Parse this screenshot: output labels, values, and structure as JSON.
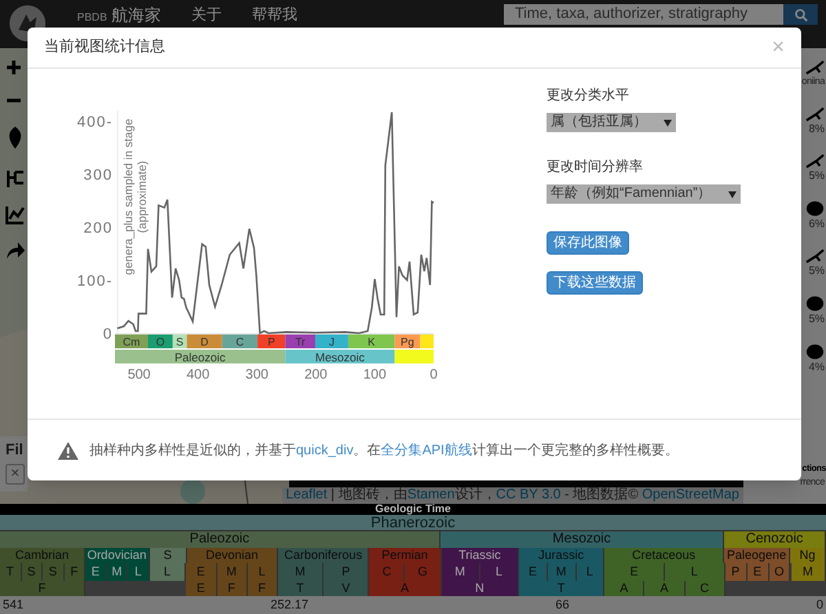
{
  "navbar": {
    "logo_small": "PBDB",
    "brand": "航海家",
    "links": [
      "关于",
      "帮帮我"
    ],
    "search": {
      "placeholder": "Time, taxa, authorizer, stratigraphy"
    }
  },
  "sidebar": {
    "filter_label": "Fil",
    "filter_clear": "×"
  },
  "taxa_panel": {
    "items": [
      {
        "kind": "bird",
        "text": "oniina"
      },
      {
        "kind": "bird",
        "text": "8%"
      },
      {
        "kind": "bird",
        "text": "5%"
      },
      {
        "kind": "blob",
        "text": "6%"
      },
      {
        "kind": "bird",
        "text": "5%"
      },
      {
        "kind": "blob",
        "text": "5%"
      },
      {
        "kind": "blob",
        "text": "4%"
      }
    ],
    "footer": [
      "ctions",
      "rrence"
    ]
  },
  "map": {
    "kind": "picture",
    "attribution": [
      {
        "kind": "link",
        "text": "Leaflet"
      },
      {
        "kind": "text",
        "text": " | 地图砖，由"
      },
      {
        "kind": "link",
        "text": "Stamen"
      },
      {
        "kind": "text",
        "text": "设计，"
      },
      {
        "kind": "link",
        "text": "CC BY 3.0"
      },
      {
        "kind": "text",
        "text": " - 地图数据© "
      },
      {
        "kind": "link",
        "text": "OpenStreetMap"
      }
    ]
  },
  "modal": {
    "title": "当前视图统计信息",
    "close": "×",
    "chart_data": {
      "type": "line",
      "xlim": [
        541,
        0
      ],
      "ylim": [
        0,
        420
      ],
      "ylabel": "genera_plus sampled in stage (approximate)",
      "xticks": [
        500,
        400,
        300,
        200,
        100,
        0
      ],
      "yticks": [
        {
          "value": 0,
          "label": "0"
        },
        {
          "value": 100,
          "label": "100-"
        },
        {
          "value": 200,
          "label": "200"
        },
        {
          "value": 300,
          "label": "300"
        },
        {
          "value": 400,
          "label": "400-"
        }
      ],
      "x": [
        537,
        526,
        518,
        510,
        506,
        502,
        501,
        488,
        485,
        479,
        471,
        467,
        457,
        452,
        444,
        438,
        432,
        428,
        424,
        420,
        416,
        409,
        393,
        387,
        381,
        371,
        360,
        346,
        330,
        323,
        313,
        305,
        301,
        295,
        288,
        280,
        250,
        200,
        150,
        127,
        112,
        105,
        100,
        95,
        90,
        84,
        82,
        71,
        63,
        59,
        53,
        45,
        41,
        34,
        27,
        21,
        16,
        12,
        6,
        3,
        0
      ],
      "series": [
        {
          "color": "#666666",
          "values": [
            9,
            13,
            23,
            17,
            4,
            4,
            37,
            37,
            159,
            116,
            126,
            241,
            237,
            252,
            67,
            122,
            100,
            67,
            65,
            48,
            39,
            22,
            168,
            163,
            91,
            50,
            91,
            148,
            170,
            122,
            197,
            161,
            109,
            0,
            4,
            0,
            2,
            1,
            2,
            0,
            4,
            48,
            102,
            65,
            35,
            35,
            317,
            417,
            30,
            126,
            109,
            100,
            135,
            35,
            39,
            148,
            117,
            142,
            91,
            248,
            246
          ]
        }
      ]
    },
    "periods": [
      {
        "label": "Cm",
        "color": "#7fa056"
      },
      {
        "label": "O",
        "color": "#1a9d6f"
      },
      {
        "label": "S",
        "color": "#b3e1b6"
      },
      {
        "label": "D",
        "color": "#cb8c37"
      },
      {
        "label": "C",
        "color": "#67a599"
      },
      {
        "label": "P",
        "color": "#f04028"
      },
      {
        "label": "Tr",
        "color": "#9a3fb0"
      },
      {
        "label": "J",
        "color": "#34b2c9"
      },
      {
        "label": "K",
        "color": "#7fc64e"
      },
      {
        "label": "Pg",
        "color": "#fd9a52"
      },
      {
        "color": "#ffe619"
      }
    ],
    "eras": [
      {
        "label": "Paleozoic",
        "color": "#99c08d"
      },
      {
        "label": "Mesozoic",
        "color": "#67c5ca"
      },
      {
        "color": "#f2f91d"
      }
    ],
    "controls": [
      {
        "kind": "select",
        "label": "更改分类水平",
        "value": "属（包括亚属）"
      },
      {
        "kind": "select",
        "label": "更改时间分辨率",
        "value": "年龄（例如“Famennian”）"
      },
      {
        "kind": "button",
        "label": "保存此图像"
      },
      {
        "kind": "button",
        "label": "下载这些数据"
      }
    ],
    "note": [
      {
        "kind": "text",
        "text": "抽样种内多样性是近似的，并基于"
      },
      {
        "kind": "link",
        "text": "quick_div"
      },
      {
        "kind": "text",
        "text": "。在"
      },
      {
        "kind": "link",
        "text": "全分集API航线"
      },
      {
        "kind": "text",
        "text": "计算出一个更完整的多样性概要。"
      }
    ]
  },
  "geologic_time": {
    "title": "Geologic Time",
    "eon": "Phanerozoic",
    "eras": [
      {
        "label": "Paleozoic",
        "color": "#4c6046"
      },
      {
        "label": "Mesozoic",
        "color": "#336265"
      },
      {
        "label": "Cenozoic",
        "color": "#797c0e"
      }
    ],
    "periods": [
      {
        "label": "Cambrian",
        "color": "#3f502b",
        "epochs": [
          "T",
          "S",
          "S",
          "F"
        ],
        "ages": [
          "F"
        ]
      },
      {
        "label": "Ordovician",
        "color": "#004938",
        "epochs": [
          "E",
          "M",
          "L"
        ]
      },
      {
        "label": "S",
        "color": "#59705b",
        "epochs": [
          "L"
        ]
      },
      {
        "label": "Devonian",
        "color": "#65461b",
        "epochs": [
          "E",
          "M",
          "L"
        ],
        "ages": [
          "E",
          "F",
          "F"
        ]
      },
      {
        "label": "Carboniferous",
        "color": "#33524c",
        "epochs": [
          "M",
          "P"
        ],
        "ages": [
          "T",
          "V"
        ]
      },
      {
        "label": "Permian",
        "color": "#782014",
        "epochs": [
          "C",
          "G"
        ],
        "ages": [
          "A"
        ]
      },
      {
        "label": "Triassic",
        "color": "#401549",
        "epochs": [
          "M",
          "L"
        ],
        "ages": [
          "N"
        ]
      },
      {
        "label": "Jurassic",
        "color": "#1a5964",
        "epochs": [
          "E",
          "M",
          "L"
        ],
        "ages": [
          "T"
        ]
      },
      {
        "label": "Cretaceous",
        "color": "#3f6327",
        "epochs": [
          "E",
          "L"
        ],
        "ages": [
          "A",
          "A",
          "C"
        ]
      },
      {
        "label": "Paleogene",
        "color": "#7e4d29",
        "epochs": [
          "P",
          "E",
          "O"
        ]
      },
      {
        "label": "Ng",
        "color": "#7f730c",
        "epochs": [
          "M"
        ]
      }
    ],
    "axis": [
      "541",
      "252.17",
      "66",
      "0"
    ]
  }
}
